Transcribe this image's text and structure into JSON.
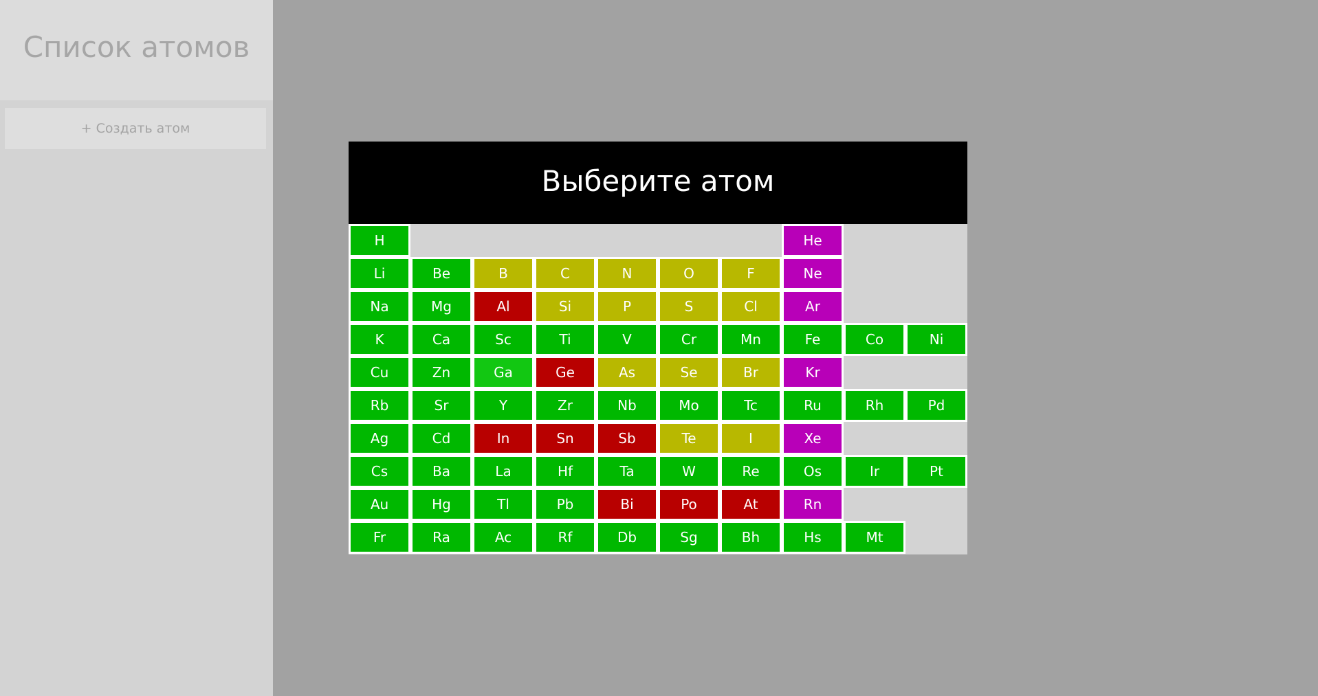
{
  "sidebar": {
    "title": "Список атомов",
    "create_button_label": "+ Создать атом"
  },
  "modal": {
    "title": "Выберите атом"
  },
  "colors": {
    "green": "#00b800",
    "light_green": "#12c712",
    "yellow": "#b8b800",
    "red": "#b80000",
    "magenta": "#b800b8"
  },
  "elements": [
    {
      "symbol": "H",
      "row": 0,
      "col": 0,
      "color": "green"
    },
    {
      "symbol": "He",
      "row": 0,
      "col": 7,
      "color": "magenta"
    },
    {
      "symbol": "Li",
      "row": 1,
      "col": 0,
      "color": "green"
    },
    {
      "symbol": "Be",
      "row": 1,
      "col": 1,
      "color": "green"
    },
    {
      "symbol": "B",
      "row": 1,
      "col": 2,
      "color": "yellow"
    },
    {
      "symbol": "C",
      "row": 1,
      "col": 3,
      "color": "yellow"
    },
    {
      "symbol": "N",
      "row": 1,
      "col": 4,
      "color": "yellow"
    },
    {
      "symbol": "O",
      "row": 1,
      "col": 5,
      "color": "yellow"
    },
    {
      "symbol": "F",
      "row": 1,
      "col": 6,
      "color": "yellow"
    },
    {
      "symbol": "Ne",
      "row": 1,
      "col": 7,
      "color": "magenta"
    },
    {
      "symbol": "Na",
      "row": 2,
      "col": 0,
      "color": "green"
    },
    {
      "symbol": "Mg",
      "row": 2,
      "col": 1,
      "color": "green"
    },
    {
      "symbol": "Al",
      "row": 2,
      "col": 2,
      "color": "red"
    },
    {
      "symbol": "Si",
      "row": 2,
      "col": 3,
      "color": "yellow"
    },
    {
      "symbol": "P",
      "row": 2,
      "col": 4,
      "color": "yellow"
    },
    {
      "symbol": "S",
      "row": 2,
      "col": 5,
      "color": "yellow"
    },
    {
      "symbol": "Cl",
      "row": 2,
      "col": 6,
      "color": "yellow"
    },
    {
      "symbol": "Ar",
      "row": 2,
      "col": 7,
      "color": "magenta"
    },
    {
      "symbol": "K",
      "row": 3,
      "col": 0,
      "color": "green"
    },
    {
      "symbol": "Ca",
      "row": 3,
      "col": 1,
      "color": "green"
    },
    {
      "symbol": "Sc",
      "row": 3,
      "col": 2,
      "color": "green"
    },
    {
      "symbol": "Ti",
      "row": 3,
      "col": 3,
      "color": "green"
    },
    {
      "symbol": "V",
      "row": 3,
      "col": 4,
      "color": "green"
    },
    {
      "symbol": "Cr",
      "row": 3,
      "col": 5,
      "color": "green"
    },
    {
      "symbol": "Mn",
      "row": 3,
      "col": 6,
      "color": "green"
    },
    {
      "symbol": "Fe",
      "row": 3,
      "col": 7,
      "color": "green"
    },
    {
      "symbol": "Co",
      "row": 3,
      "col": 8,
      "color": "green"
    },
    {
      "symbol": "Ni",
      "row": 3,
      "col": 9,
      "color": "green"
    },
    {
      "symbol": "Cu",
      "row": 4,
      "col": 0,
      "color": "green"
    },
    {
      "symbol": "Zn",
      "row": 4,
      "col": 1,
      "color": "green"
    },
    {
      "symbol": "Ga",
      "row": 4,
      "col": 2,
      "color": "light_green"
    },
    {
      "symbol": "Ge",
      "row": 4,
      "col": 3,
      "color": "red"
    },
    {
      "symbol": "As",
      "row": 4,
      "col": 4,
      "color": "yellow"
    },
    {
      "symbol": "Se",
      "row": 4,
      "col": 5,
      "color": "yellow"
    },
    {
      "symbol": "Br",
      "row": 4,
      "col": 6,
      "color": "yellow"
    },
    {
      "symbol": "Kr",
      "row": 4,
      "col": 7,
      "color": "magenta"
    },
    {
      "symbol": "Rb",
      "row": 5,
      "col": 0,
      "color": "green"
    },
    {
      "symbol": "Sr",
      "row": 5,
      "col": 1,
      "color": "green"
    },
    {
      "symbol": "Y",
      "row": 5,
      "col": 2,
      "color": "green"
    },
    {
      "symbol": "Zr",
      "row": 5,
      "col": 3,
      "color": "green"
    },
    {
      "symbol": "Nb",
      "row": 5,
      "col": 4,
      "color": "green"
    },
    {
      "symbol": "Mo",
      "row": 5,
      "col": 5,
      "color": "green"
    },
    {
      "symbol": "Tc",
      "row": 5,
      "col": 6,
      "color": "green"
    },
    {
      "symbol": "Ru",
      "row": 5,
      "col": 7,
      "color": "green"
    },
    {
      "symbol": "Rh",
      "row": 5,
      "col": 8,
      "color": "green"
    },
    {
      "symbol": "Pd",
      "row": 5,
      "col": 9,
      "color": "green"
    },
    {
      "symbol": "Ag",
      "row": 6,
      "col": 0,
      "color": "green"
    },
    {
      "symbol": "Cd",
      "row": 6,
      "col": 1,
      "color": "green"
    },
    {
      "symbol": "In",
      "row": 6,
      "col": 2,
      "color": "red"
    },
    {
      "symbol": "Sn",
      "row": 6,
      "col": 3,
      "color": "red"
    },
    {
      "symbol": "Sb",
      "row": 6,
      "col": 4,
      "color": "red"
    },
    {
      "symbol": "Te",
      "row": 6,
      "col": 5,
      "color": "yellow"
    },
    {
      "symbol": "I",
      "row": 6,
      "col": 6,
      "color": "yellow"
    },
    {
      "symbol": "Xe",
      "row": 6,
      "col": 7,
      "color": "magenta"
    },
    {
      "symbol": "Cs",
      "row": 7,
      "col": 0,
      "color": "green"
    },
    {
      "symbol": "Ba",
      "row": 7,
      "col": 1,
      "color": "green"
    },
    {
      "symbol": "La",
      "row": 7,
      "col": 2,
      "color": "green"
    },
    {
      "symbol": "Hf",
      "row": 7,
      "col": 3,
      "color": "green"
    },
    {
      "symbol": "Ta",
      "row": 7,
      "col": 4,
      "color": "green"
    },
    {
      "symbol": "W",
      "row": 7,
      "col": 5,
      "color": "green"
    },
    {
      "symbol": "Re",
      "row": 7,
      "col": 6,
      "color": "green"
    },
    {
      "symbol": "Os",
      "row": 7,
      "col": 7,
      "color": "green"
    },
    {
      "symbol": "Ir",
      "row": 7,
      "col": 8,
      "color": "green"
    },
    {
      "symbol": "Pt",
      "row": 7,
      "col": 9,
      "color": "green"
    },
    {
      "symbol": "Au",
      "row": 8,
      "col": 0,
      "color": "green"
    },
    {
      "symbol": "Hg",
      "row": 8,
      "col": 1,
      "color": "green"
    },
    {
      "symbol": "Tl",
      "row": 8,
      "col": 2,
      "color": "green"
    },
    {
      "symbol": "Pb",
      "row": 8,
      "col": 3,
      "color": "green"
    },
    {
      "symbol": "Bi",
      "row": 8,
      "col": 4,
      "color": "red"
    },
    {
      "symbol": "Po",
      "row": 8,
      "col": 5,
      "color": "red"
    },
    {
      "symbol": "At",
      "row": 8,
      "col": 6,
      "color": "red"
    },
    {
      "symbol": "Rn",
      "row": 8,
      "col": 7,
      "color": "magenta"
    },
    {
      "symbol": "Fr",
      "row": 9,
      "col": 0,
      "color": "green"
    },
    {
      "symbol": "Ra",
      "row": 9,
      "col": 1,
      "color": "green"
    },
    {
      "symbol": "Ac",
      "row": 9,
      "col": 2,
      "color": "green"
    },
    {
      "symbol": "Rf",
      "row": 9,
      "col": 3,
      "color": "green"
    },
    {
      "symbol": "Db",
      "row": 9,
      "col": 4,
      "color": "green"
    },
    {
      "symbol": "Sg",
      "row": 9,
      "col": 5,
      "color": "green"
    },
    {
      "symbol": "Bh",
      "row": 9,
      "col": 6,
      "color": "green"
    },
    {
      "symbol": "Hs",
      "row": 9,
      "col": 7,
      "color": "green"
    },
    {
      "symbol": "Mt",
      "row": 9,
      "col": 8,
      "color": "green"
    }
  ]
}
